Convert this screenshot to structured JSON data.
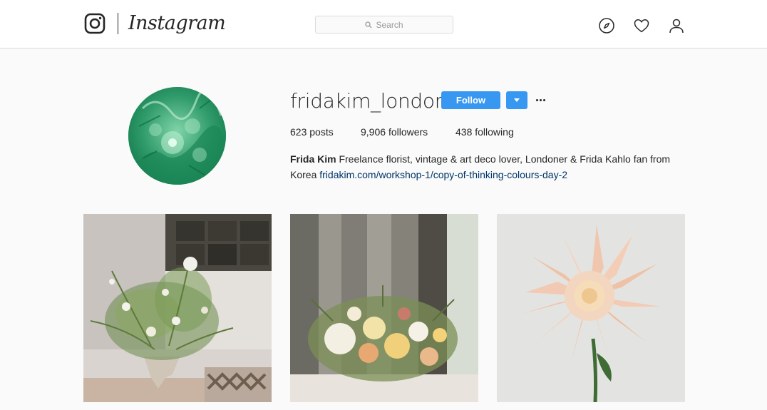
{
  "header": {
    "wordmark": "Instagram",
    "search_placeholder": "Search",
    "icons": [
      "instagram-logo-icon",
      "search-icon",
      "compass-icon",
      "heart-icon",
      "person-icon"
    ]
  },
  "profile": {
    "username": "fridakim_london",
    "follow_label": "Follow",
    "stats": {
      "posts_count": "623",
      "posts_label": "posts",
      "followers_count": "9,906",
      "followers_label": "followers",
      "following_count": "438",
      "following_label": "following"
    },
    "bio": {
      "name": "Frida Kim",
      "text": "Freelance florist, vintage & art deco lover, Londoner & Frida Kahlo fan from Korea",
      "link": "fridakim.com/workshop-1/copy-of-thinking-colours-day-2"
    }
  },
  "colors": {
    "accent": "#3897f0",
    "link": "#003569",
    "background": "#fafafa"
  }
}
